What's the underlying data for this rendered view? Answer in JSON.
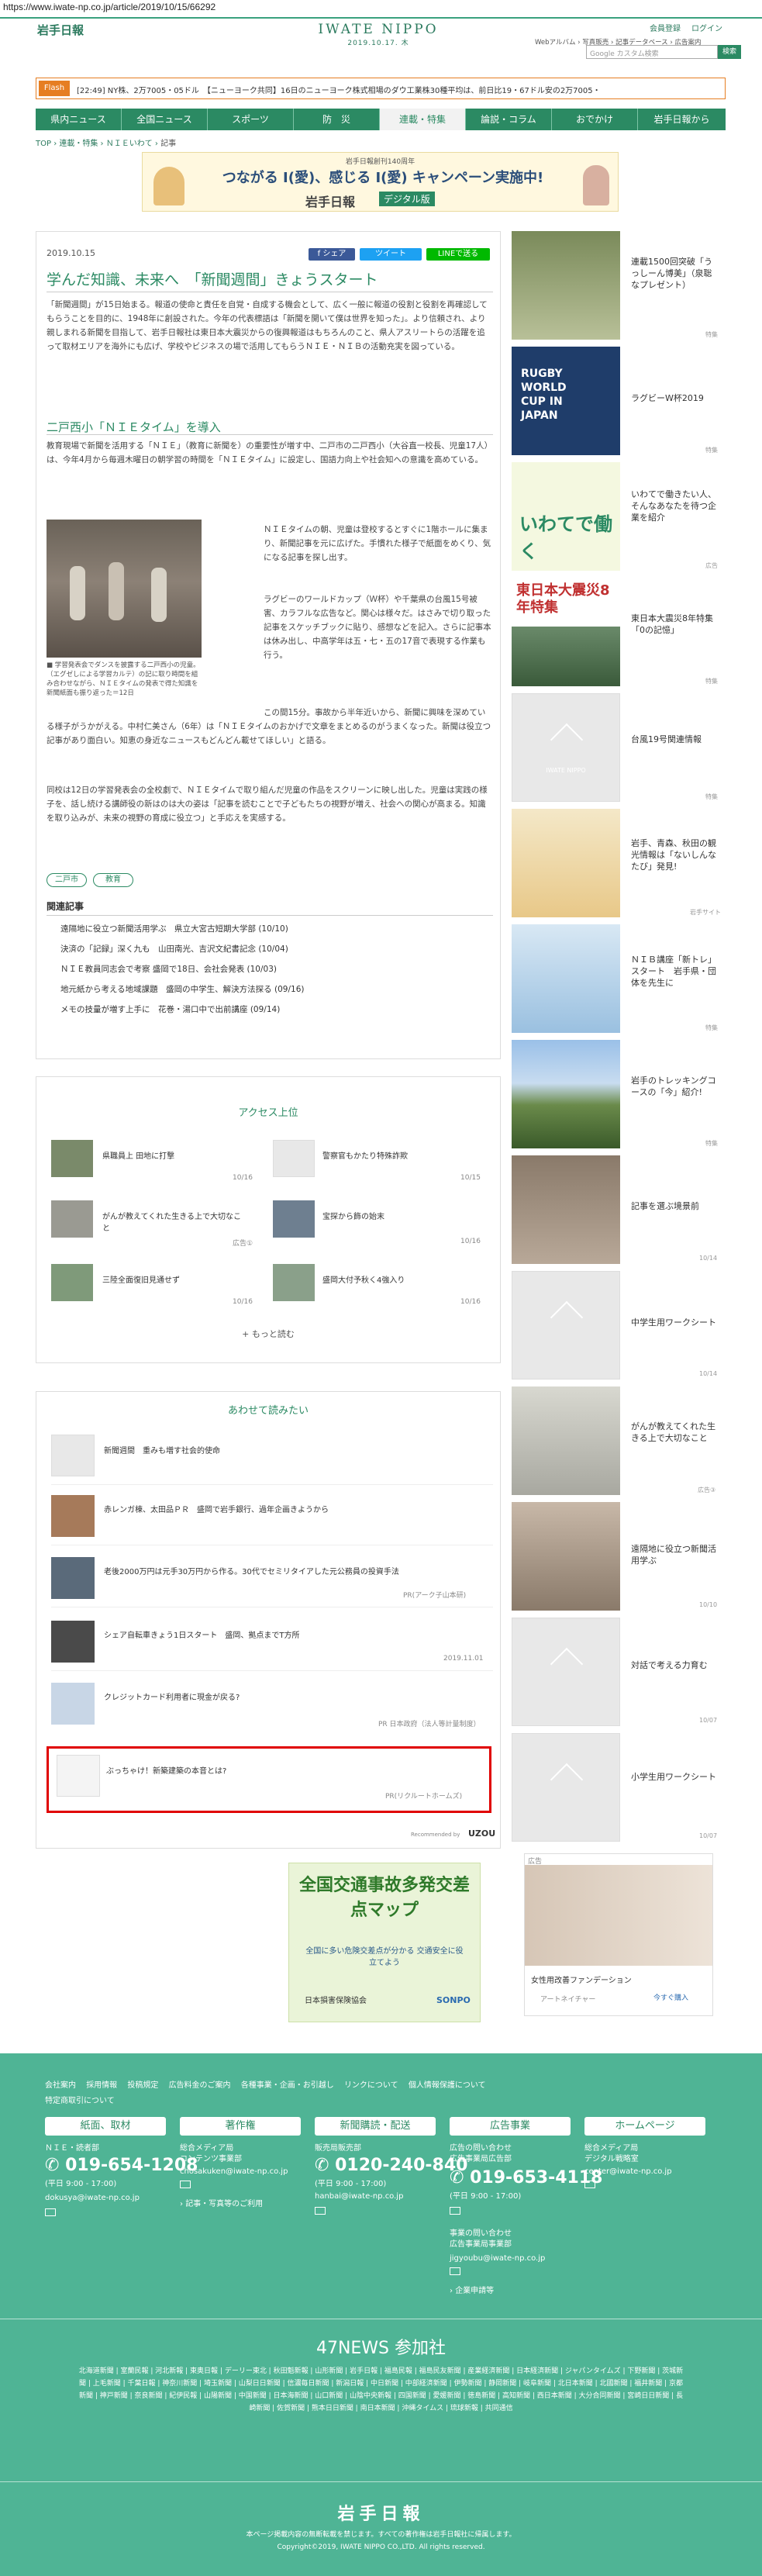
{
  "url": "https://www.iwate-np.co.jp/article/2019/10/15/66292",
  "header": {
    "logo_small": "岩手日報",
    "brand": "IWATE NIPPO",
    "date": "2019.10.17. 木",
    "register": "会員登録",
    "login": "ログイン",
    "links": [
      "Webアルバム",
      "写真販売",
      "記事データベース",
      "広告案内"
    ],
    "search_placeholder": "Google カスタム検索",
    "search_btn": "検索"
  },
  "ticker": {
    "flash": "Flash",
    "text": "[22:49] NY株、2万7005・05ドル　【ニューヨーク共同】16日のニューヨーク株式相場のダウ工業株30種平均は、前日比19・67ドル安の2万7005・"
  },
  "nav": [
    "県内ニュース",
    "全国ニュース",
    "スポーツ",
    "防　災",
    "連載・特集",
    "論説・コラム",
    "おでかけ",
    "岩手日報から"
  ],
  "breadcrumb": [
    "TOP",
    "連載・特集",
    "ＮＩＥいわて",
    "記事"
  ],
  "banner": {
    "small": "岩手日報創刊140周年",
    "main": "つながる I(愛)、感じる I(愛) キャンペーン実施中!",
    "logo": "岩手日報",
    "logo2": "デジタル版"
  },
  "article": {
    "date": "2019.10.15",
    "share": [
      "シェア",
      "ツイート",
      "LINEで送る"
    ],
    "title": "学んだ知識、未来へ　「新聞週間」きょうスタート",
    "p1": "「新聞週間」が15日始まる。報道の使命と責任を自覚・自成する機会として、広く一般に報道の役割と役割を再確認してもらうことを目的に、1948年に創設された。今年の代表標語は「新聞を開いて僕は世界を知った」。より信頼され、より親しまれる新聞を目指して、岩手日報社は東日本大震災からの復興報道はもちろんのこと、県人アスリートらの活躍を追って取材エリアを海外にも広げ、学校やビジネスの場で活用してもらうＮＩＥ・ＮＩＢの活動充実を図っている。",
    "sub": "二戸西小「ＮＩＥタイム」を導入",
    "p2": "教育現場で新聞を活用する「ＮＩＥ」（教育に新聞を）の重要性が増す中、二戸市の二戸西小（大谷直一校長、児童17人）は、今年4月から毎週木曜日の朝学習の時間を「ＮＩＥタイム」に設定し、国語力向上や社会知への意識を高めている。",
    "caption": "■ 学習発表会でダンスを披露する二戸西小の児童。（エグゼしによる学習カルテ）の記に取り時間を組み合わせながら、ＮＩＥタイムの発表で得た知識を新聞紙面も振り返った＝12日",
    "p3": "ＮＩＥタイムの朝、児童は登校するとすぐに1階ホールに集まり、新聞記事を元に広げた。手慣れた様子で紙面をめくり、気になる記事を探し出す。",
    "p4": "ラグビーのワールドカップ（Ｗ杯）や千葉県の台風15号被害、カラフルな広告など。関心は様々だ。はさみで切り取った記事をスケッチブックに貼り、感想などを記入。さらに記事本は休み出し、中高学年は五・七・五の17音で表現する作業も行う。",
    "p5": "この間15分。事故から半年近いから、新聞に興味を深めている様子がうかがえる。中村仁美さん（6年）は「ＮＩＥタイムのおかげで文章をまとめるのがうまくなった。新聞は役立つ記事があり面白い。知恵の身近なニュースもどんどん載せてほしい」と語る。",
    "p6": "同校は12日の学習発表会の全校劇で、ＮＩＥタイムで取り組んだ児童の作品をスクリーンに映し出した。児童は実践の様子を、話し続ける講師役の新はのは大の姿は「記事を読むことで子どもたちの視野が増え、社会への関心が高まる。知識を取り込みが、未来の視野の育成に役立つ」と手応えを実感する。",
    "tags": [
      "二戸市",
      "教育"
    ],
    "related_title": "関連記事",
    "related": [
      "遠隔地に役立つ新聞活用学ぶ　県立大宮古短期大学部 (10/10)",
      "決済の「記録」深く九も　山田南光、吉沢文紀書記念 (10/04)",
      "ＮＩＥ教員同志会で考察 盛岡で18日、会社会発表 (10/03)",
      "地元紙から考える地域課題　盛岡の中学生、解決方法探る (09/16)",
      "メモの技量が増す上手に　花巻・湯口中で出前講座 (09/14)"
    ]
  },
  "access": {
    "title": "アクセス上位",
    "items": [
      {
        "t": "県職員上 田地に打撃",
        "d": "10/16"
      },
      {
        "t": "警察官もかたり特殊詐欺",
        "d": "10/15"
      },
      {
        "t": "がんが教えてくれた生きる上で大切なこと",
        "d": "広告①"
      },
      {
        "t": "宝探から飾の始末",
        "d": "10/16"
      },
      {
        "t": "三陸全面復旧見通せず",
        "d": "10/16"
      },
      {
        "t": "盛岡大付予秋く4強入り",
        "d": "10/16"
      }
    ],
    "more": "もっと読む"
  },
  "reco": {
    "title": "あわせて読みたい",
    "items": [
      {
        "t": "新聞週間　重みも増す社会的使命",
        "s": ""
      },
      {
        "t": "赤レンガ棟、太田品ＰＲ　盛岡で岩手銀行、過年企画きようから",
        "s": ""
      },
      {
        "t": "老後2000万円は元手30万円から作る。30代でセミリタイアした元公務員の投資手法",
        "s": "PR(アーク子山本研)"
      },
      {
        "t": "シェア自転車きょう1日スタート　盛岡、拠点までT方所",
        "s": "2019.11.01"
      },
      {
        "t": "クレジットカード利用者に現金が戻る?",
        "s": "PR 日本政府（法人等計量制度）"
      },
      {
        "t": "ぶっちゃけ！新築建築の本音とは?",
        "s": "PR(リクルートホームズ)"
      }
    ],
    "powered": "Recommended by",
    "uzou": "UZOU"
  },
  "ad": {
    "main": "全国交通事故多発交差点マップ",
    "sub": "全国に多い危険交差点が分かる 交通安全に役立てよう",
    "org": "日本損害保険協会",
    "sponsor": "SONPO",
    "side_title": "女性用改善ファンデーション",
    "side_brand": "アートネイチャー",
    "side_btn": "今すぐ購入",
    "ad_label": "広告"
  },
  "sidebar": [
    {
      "t": "連載1500回突破「うっしーん博美」（泉聡なプレゼント）",
      "g": "特集"
    },
    {
      "t": "ラグビーW杯2019",
      "g": "特集"
    },
    {
      "t": "いわてで働きたい人、そんなあなたを待つ企業を紹介",
      "g": "広告"
    },
    {
      "t": "東日本大震災8年特集「0の記憶」",
      "g": "特集"
    },
    {
      "t": "台風19号関連情報",
      "g": "特集"
    },
    {
      "t": "岩手、青森、秋田の観光情報は「ないしんなたび」発見!",
      "g": "岩手サイト"
    },
    {
      "t": "ＮＩＢ講座「新トレ」スタート　岩手県・団体を先生に",
      "g": "特集"
    },
    {
      "t": "岩手のトレッキングコースの「今」紹介!",
      "g": "特集"
    },
    {
      "t": "記事を選ぶ境景前",
      "g": "10/14"
    },
    {
      "t": "中学生用ワークシート",
      "g": "10/14"
    },
    {
      "t": "がんが教えてくれた生きる上で大切なこと",
      "g": "広告③"
    },
    {
      "t": "遠隔地に役立つ新聞活用学ぶ",
      "g": "10/10"
    },
    {
      "t": "対話で考える力育む",
      "g": "10/07"
    },
    {
      "t": "小学生用ワークシート",
      "g": "10/07"
    }
  ],
  "side_images": {
    "rugby": "RUGBY WORLD CUP IN JAPAN",
    "work": "いわてで働く",
    "quake": "東日本大震災8年特集",
    "iwate": "IWATE NIPPO"
  },
  "footer": {
    "links": [
      "会社案内",
      "採用情報",
      "投稿規定",
      "広告料金のご案内",
      "各種事業・企画・お引越し",
      "リンクについて",
      "個人情報保護について",
      "特定商取引について"
    ],
    "boxes": [
      "紙面、取材",
      "著作権",
      "新聞購読・配送",
      "広告事業",
      "ホームページ"
    ],
    "c1": {
      "l1": "ＮＩＥ・読者部",
      "tel": "019-654-1208",
      "hours": "(平日 9:00 - 17:00)",
      "mail": "dokusya@iwate-np.co.jp"
    },
    "c2": {
      "l1": "総合メディア局",
      "l2": "コンテンツ事業部",
      "mail": "chosakuken@iwate-np.co.jp",
      "link": "記事・写真等のご利用"
    },
    "c3": {
      "l1": "販売局販売部",
      "tel": "0120-240-840",
      "hours": "(平日 9:00 - 17:00)",
      "mail": "hanbai@iwate-np.co.jp"
    },
    "c4": {
      "l1": "広告の問い合わせ",
      "l2": "広告事業局広告部",
      "tel": "019-653-4118",
      "hours": "(平日 9:00 - 17:00)",
      "l3": "事業の問い合わせ",
      "l4": "広告事業局事業部",
      "mail": "jigyoubu@iwate-np.co.jp",
      "link": "企業申請等"
    },
    "c5": {
      "l1": "総合メディア局",
      "l2": "デジタル戦略室",
      "mail": "center@iwate-np.co.jp"
    },
    "n47": "47NEWS 参加社",
    "papers": "北海道新聞 | 室蘭民報 | 河北新報 | 東奥日報 | デーリー東北 | 秋田魁新報 | 山形新聞 | 岩手日報 | 福島民報 | 福島民友新聞 | 産業経済新聞 | 日本経済新聞 | ジャパンタイムズ | 下野新聞 | 茨城新聞 | 上毛新聞 | 千葉日報 | 神奈川新聞 | 埼玉新聞 | 山梨日日新聞 | 信濃毎日新聞 | 新潟日報 | 中日新聞 | 中部経済新聞 | 伊勢新聞 | 静岡新聞 | 岐阜新聞 | 北日本新聞 | 北國新聞 | 福井新聞 | 京都新聞 | 神戸新聞 | 奈良新聞 | 紀伊民報 | 山陽新聞 | 中国新聞 | 日本海新聞 | 山口新聞 | 山陰中央新報 | 四国新聞 | 愛媛新聞 | 徳島新聞 | 高知新聞 | 西日本新聞 | 大分合同新聞 | 宮崎日日新聞 | 長崎新聞 | 佐賀新聞 | 熊本日日新聞 | 南日本新聞 | 沖縄タイムス | 琉球新報 | 共同通信",
    "logo": "岩手日報",
    "copy1": "本ページ掲載内容の無断転載を禁じます。すべての著作権は岩手日報社に帰属します。",
    "copy2": "Copyright©2019, IWATE NIPPO CO.,LTD. All rights reserved."
  },
  "colors": {
    "brand": "#2b8a63",
    "footer": "#4fb495",
    "flash": "#e67e22",
    "highlight": "#e00000"
  }
}
